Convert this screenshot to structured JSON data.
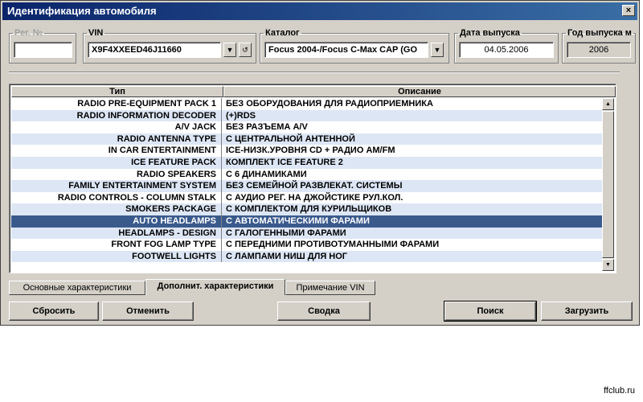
{
  "window": {
    "title": "Идентификация автомобиля",
    "close_glyph": "×"
  },
  "fields": {
    "reg": {
      "label": "Рег. №",
      "value": ""
    },
    "vin": {
      "label": "VIN",
      "value": "X9F4XXEED46J11660"
    },
    "catalog": {
      "label": "Каталог",
      "value": "Focus 2004-/Focus C-Max CAP (GO"
    },
    "release_date": {
      "label": "Дата выпуска",
      "value": "04.05.2006"
    },
    "release_year": {
      "label": "Год выпуска м",
      "value": "2006"
    }
  },
  "table": {
    "headers": [
      "Тип",
      "Описание"
    ],
    "selected_index": 10,
    "rows": [
      {
        "type": "RADIO PRE-EQUIPMENT PACK 1",
        "desc": "БЕЗ ОБОРУДОВАНИЯ ДЛЯ РАДИОПРИЕМНИКА"
      },
      {
        "type": "RADIO INFORMATION DECODER",
        "desc": "(+)RDS"
      },
      {
        "type": "A/V JACK",
        "desc": "БЕЗ РАЗЪЕМА A/V"
      },
      {
        "type": "RADIO ANTENNA TYPE",
        "desc": "С ЦЕНТРАЛЬНОЙ АНТЕННОЙ"
      },
      {
        "type": "IN CAR ENTERTAINMENT",
        "desc": "ICE-НИЗК.УРОВНЯ CD + РАДИО AM/FM"
      },
      {
        "type": "ICE FEATURE PACK",
        "desc": "КОМПЛЕКТ ICE FEATURE 2"
      },
      {
        "type": "RADIO SPEAKERS",
        "desc": "С 6 ДИНАМИКАМИ"
      },
      {
        "type": "FAMILY ENTERTAINMENT SYSTEM",
        "desc": "БЕЗ СЕМЕЙНОЙ РАЗВЛЕКАТ. СИСТЕМЫ"
      },
      {
        "type": "RADIO CONTROLS - COLUMN STALK",
        "desc": "С АУДИО РЕГ. НА ДЖОЙСТИКЕ РУЛ.КОЛ."
      },
      {
        "type": "SMOKERS PACKAGE",
        "desc": "С КОМПЛЕКТОМ ДЛЯ КУРИЛЬЩИКОВ"
      },
      {
        "type": "AUTO HEADLAMPS",
        "desc": "С АВТОМАТИЧЕСКИМИ ФАРАМИ"
      },
      {
        "type": "HEADLAMPS - DESIGN",
        "desc": "С ГАЛОГЕННЫМИ ФАРАМИ"
      },
      {
        "type": "FRONT FOG LAMP TYPE",
        "desc": "С ПЕРЕДНИМИ ПРОТИВОТУМАННЫМИ ФАРАМИ"
      },
      {
        "type": "FOOTWELL LIGHTS",
        "desc": "С ЛАМПАМИ НИШ ДЛЯ НОГ"
      }
    ]
  },
  "tabs": [
    {
      "label": "Основные характеристики"
    },
    {
      "label": "Дополнит. характеристики"
    },
    {
      "label": "Примечание VIN"
    }
  ],
  "buttons": {
    "reset": "Сбросить",
    "cancel": "Отменить",
    "summary": "Сводка",
    "search": "Поиск",
    "load": "Загрузить"
  },
  "watermark": "ffclub.ru",
  "colors": {
    "title_bar": "#0a246a",
    "selected_row": "#3a5a8c",
    "alt_row": "#dde6f5"
  }
}
